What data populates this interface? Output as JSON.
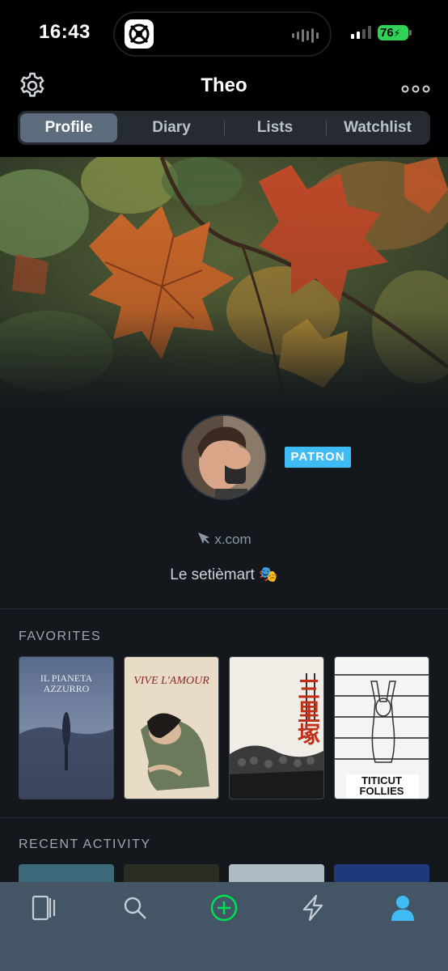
{
  "status_bar": {
    "time": "16:43",
    "battery": "76",
    "battery_color": "#32d158"
  },
  "header": {
    "title": "Theo",
    "settings_icon": "gear-icon",
    "more_icon": "ellipsis-icon"
  },
  "tabs": [
    {
      "label": "Profile",
      "active": true
    },
    {
      "label": "Diary",
      "active": false
    },
    {
      "label": "Lists",
      "active": false
    },
    {
      "label": "Watchlist",
      "active": false
    }
  ],
  "profile": {
    "badge": "PATRON",
    "badge_color": "#40bcf4",
    "website": "x.com",
    "bio": "Le setièmart 🎭"
  },
  "favorites": {
    "heading": "FAVORITES",
    "posters": [
      {
        "title_line1": "IL PIANETA",
        "title_line2": "AZZURRO"
      },
      {
        "title_line1": "VIVE L'AMOUR"
      },
      {
        "title_line1": "三里塚"
      },
      {
        "title_line1": "TITICUT",
        "title_line2": "FOLLIES"
      }
    ]
  },
  "recent_activity": {
    "heading": "RECENT ACTIVITY"
  },
  "tab_bar": {
    "items": [
      "films-icon",
      "search-icon",
      "add-icon",
      "activity-icon",
      "profile-icon"
    ],
    "accent": "#40bcf4",
    "add_color": "#00e054"
  }
}
